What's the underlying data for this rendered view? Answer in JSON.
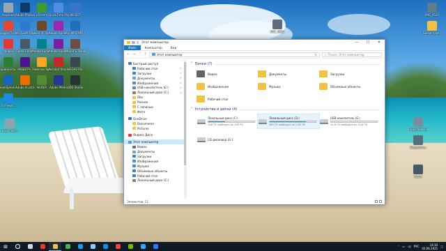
{
  "desktop": {
    "icons_left": [
      {
        "label": "Корзина",
        "color": "#9aa7b3"
      },
      {
        "label": "Adobe Photosh...",
        "color": "#0b3a6b"
      },
      {
        "label": "uTorrent",
        "color": "#3f9b2f"
      },
      {
        "label": "QuickTime Player",
        "color": "#4d8fd8"
      },
      {
        "label": "WinSCP",
        "color": "#3a73c8"
      },
      {
        "label": "Google Chrome",
        "color": "#e2472f"
      },
      {
        "label": "Microsoft Edge",
        "color": "#2a7bd1"
      },
      {
        "label": "World of Tanks RU",
        "color": "#6b4a2a"
      },
      {
        "label": "Adobe Audit...",
        "color": "#9c27b0"
      },
      {
        "label": "AnyMP4 MP4 Converter",
        "color": "#1f6fbf"
      },
      {
        "label": "Yandex",
        "color": "#e53935"
      },
      {
        "label": "Game Center",
        "color": "#455a64"
      },
      {
        "label": "Adobe Audio CC 2018",
        "color": "#00838f"
      },
      {
        "label": "Adobe Audit...",
        "color": "#7b1fa2"
      },
      {
        "label": "Mount & Blade II Ba...",
        "color": "#6d4c41"
      },
      {
        "label": "Скриншоты - Ярлык",
        "color": "#2e7d32"
      },
      {
        "label": "Adobe Pr...",
        "color": "#4a148c"
      },
      {
        "label": "Заметки Ярлык",
        "color": "#f9a825"
      },
      {
        "label": "Acrobat Reader",
        "color": "#c62828"
      },
      {
        "label": "VEGAS Pro",
        "color": "#37474f"
      },
      {
        "label": "TeamSpeak 3 Client",
        "color": "#1565c0"
      },
      {
        "label": "Adobe Illustra...",
        "color": "#ef6c00"
      },
      {
        "label": "NVIDIA",
        "color": "#558b2f"
      },
      {
        "label": "Adobe Media",
        "color": "#283593"
      },
      {
        "label": "OBS Studio",
        "color": "#263238"
      },
      {
        "label": "Оптимиз...",
        "color": "#1e88e5"
      },
      {
        "label": "ВКонтакте",
        "color": "#90a4ae"
      }
    ],
    "icons_right": [
      {
        "label": "IMG_4520",
        "color": "#607d8b"
      },
      {
        "label": "Новая папка",
        "color": "#f3c046"
      },
      {
        "label": "Виды ярлыка",
        "color": "#78909c"
      },
      {
        "label": "Ведомость",
        "color": "#546e7a"
      },
      {
        "label": "Фото",
        "color": "#455a64"
      }
    ],
    "icon_mid": {
      "label": "ARC_0451",
      "color": "#5d6d7e"
    }
  },
  "window": {
    "title": "Этот компьютер",
    "ribbon_tabs": [
      "Файл",
      "Компьютер",
      "Вид"
    ],
    "address": "Этот компьютер",
    "search_placeholder": "Поиск: Этот компьютер",
    "nav": [
      {
        "label": "Быстрый доступ",
        "color": "#3a7bd5",
        "pin": false,
        "gap_after": false
      },
      {
        "label": "Рабочий стол",
        "color": "#3f7fbf",
        "pin": true
      },
      {
        "label": "Загрузки",
        "color": "#2e86de",
        "pin": true
      },
      {
        "label": "Документы",
        "color": "#8a9bb0",
        "pin": true
      },
      {
        "label": "Изображения",
        "color": "#4a90c8",
        "pin": true
      },
      {
        "label": "USB-накопитель (E:)",
        "color": "#7d8186",
        "pin": true
      },
      {
        "label": "Локальный диск (C:)",
        "color": "#7d8186",
        "pin": true
      },
      {
        "label": "Obs",
        "color": "#f3c046",
        "pin": false
      },
      {
        "label": "Разное",
        "color": "#f3c046",
        "pin": false
      },
      {
        "label": "С записью",
        "color": "#f3c046",
        "pin": false
      },
      {
        "label": "Фото",
        "color": "#f3c046",
        "pin": false
      },
      {
        "label": "OneDrive",
        "color": "#2b6fd0",
        "pin": false
      },
      {
        "label": "Documents",
        "color": "#f3c046",
        "pin": false
      },
      {
        "label": "Pictures",
        "color": "#f3c046",
        "pin": false
      },
      {
        "label": "Яндекс.Диск",
        "color": "#e53935",
        "pin": false
      },
      {
        "label": "Этот компьютер",
        "color": "#5b9bd5",
        "pin": false,
        "selected": true
      },
      {
        "label": "Видео",
        "color": "#6d6d6d",
        "pin": false
      },
      {
        "label": "Документы",
        "color": "#8a9bb0",
        "pin": false
      },
      {
        "label": "Загрузки",
        "color": "#2e86de",
        "pin": false
      },
      {
        "label": "Изображения",
        "color": "#4a90c8",
        "pin": false
      },
      {
        "label": "Музыка",
        "color": "#4a90c8",
        "pin": false
      },
      {
        "label": "Объемные объекты",
        "color": "#3f7fbf",
        "pin": false
      },
      {
        "label": "Рабочий стол",
        "color": "#3f7fbf",
        "pin": false
      },
      {
        "label": "Локальный диск (C:)",
        "color": "#7d8186",
        "pin": false
      }
    ],
    "folders_header": "Папки (7)",
    "folders": [
      {
        "label": "Видео",
        "color": "#5f6368"
      },
      {
        "label": "Документы",
        "color": "#f3c046"
      },
      {
        "label": "Загрузки",
        "color": "#f3c046"
      },
      {
        "label": "Изображения",
        "color": "#f3c046"
      },
      {
        "label": "Музыка",
        "color": "#f3c046"
      },
      {
        "label": "Объемные объекты",
        "color": "#f3c046"
      },
      {
        "label": "Рабочий стол",
        "color": "#f3c046"
      }
    ],
    "drives_header": "Устройства и диски (4)",
    "drives": [
      {
        "name": "Локальный диск (C:)",
        "free": "128 ГБ свободно из 199 ГБ",
        "used_fraction": 0.36,
        "hover": false
      },
      {
        "name": "Локальный диск (D:)",
        "free": "389 ГБ свободно из 1,82 ТБ",
        "used_fraction": 0.79,
        "hover": true
      },
      {
        "name": "USB-накопитель (E:)",
        "free": "14,6 ГБ свободно из 14,6 ГБ",
        "used_fraction": 0.0,
        "hover": false
      },
      {
        "name": "CD-дисковод (G:)",
        "free": "",
        "used_fraction": null,
        "hover": false
      }
    ],
    "status": "Элементов: 11"
  },
  "taskbar": {
    "apps": [
      {
        "name": "search",
        "color": "#ffffff"
      },
      {
        "name": "task-view",
        "color": "#cfd8dc"
      },
      {
        "name": "opera",
        "color": "#e53935"
      },
      {
        "name": "explorer",
        "color": "#f3c046"
      },
      {
        "name": "chrome",
        "color": "#4caf50"
      },
      {
        "name": "edge",
        "color": "#2196f3"
      },
      {
        "name": "store",
        "color": "#90caf9"
      },
      {
        "name": "mail",
        "color": "#1e88e5"
      },
      {
        "name": "yandex",
        "color": "#f44336"
      },
      {
        "name": "nvidia",
        "color": "#76b900"
      },
      {
        "name": "photoshop",
        "color": "#31a8ff"
      },
      {
        "name": "teamspeak",
        "color": "#2979ff"
      }
    ],
    "lang": "РУС",
    "time": "14:10",
    "date": "03.06.2021"
  }
}
